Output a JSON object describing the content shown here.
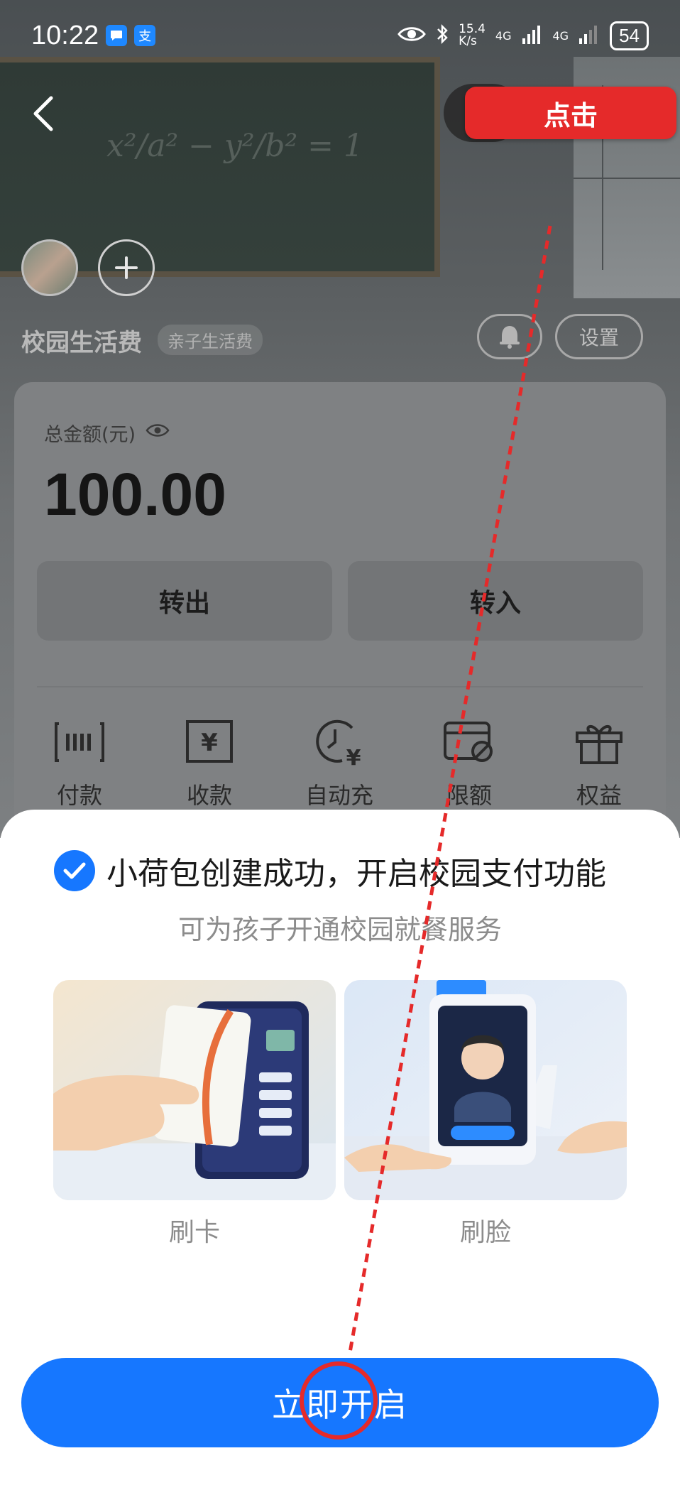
{
  "status_bar": {
    "time": "10:22",
    "app_icon_2": "支",
    "net_speed_top": "15.4",
    "net_speed_bottom": "K/s",
    "signal_1": "4G",
    "signal_2": "4G",
    "battery": "54"
  },
  "header": {
    "click_tag": "点击"
  },
  "wallet": {
    "title": "校园生活费",
    "tag": "亲子生活费",
    "settings_label": "设置",
    "amount_label": "总金额(元)",
    "amount": "100.00",
    "transfer_out": "转出",
    "transfer_in": "转入",
    "functions": [
      {
        "label": "付款",
        "icon": "barcode-icon"
      },
      {
        "label": "收款",
        "icon": "receive-money-icon"
      },
      {
        "label": "自动充",
        "icon": "auto-recharge-icon"
      },
      {
        "label": "限额",
        "icon": "limit-icon"
      },
      {
        "label": "权益",
        "icon": "gift-icon"
      }
    ]
  },
  "sheet": {
    "title": "小荷包创建成功，开启校园支付功能",
    "subtitle": "可为孩子开通校园就餐服务",
    "features": [
      {
        "label": "刷卡"
      },
      {
        "label": "刷脸"
      }
    ],
    "primary_button": "立即开启"
  },
  "colors": {
    "accent": "#1677ff",
    "annotation_red": "#e52a2a"
  }
}
